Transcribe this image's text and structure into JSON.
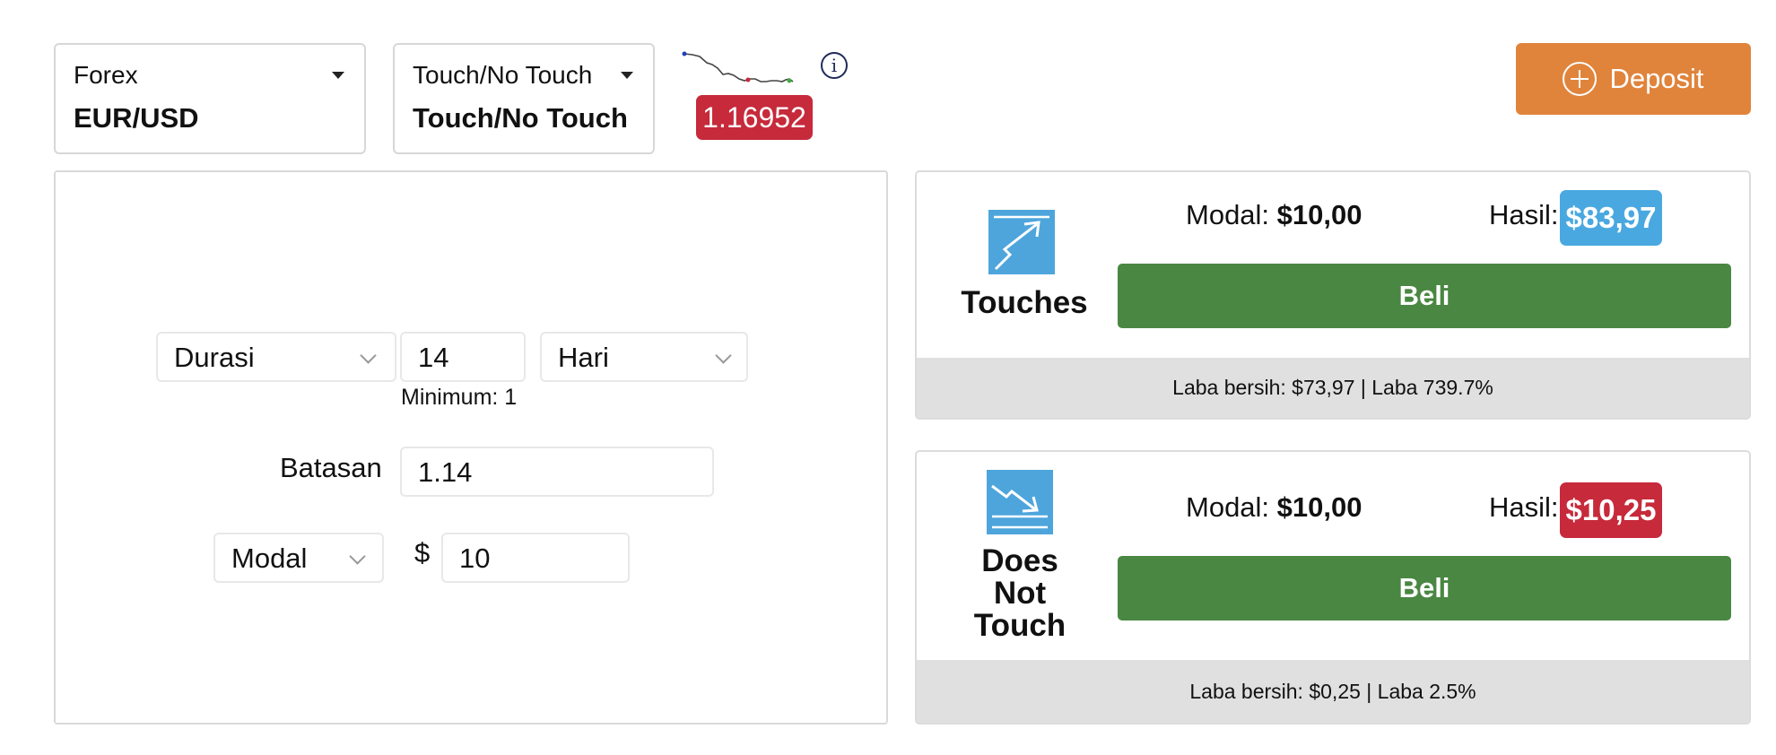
{
  "selectors": {
    "market": {
      "category": "Forex",
      "value": "EUR/USD"
    },
    "type": {
      "category": "Touch/No Touch",
      "value": "Touch/No Touch"
    }
  },
  "price": "1.16952",
  "info_icon": "info-icon",
  "deposit": {
    "label": "Deposit",
    "icon": "plus-circle-icon"
  },
  "form": {
    "duration_select": "Durasi",
    "duration_value": "14",
    "duration_unit": "Hari",
    "minimum": "Minimum: 1",
    "barrier_label": "Batasan",
    "barrier_value": "1.14",
    "amount_select": "Modal",
    "currency_symbol": "$",
    "amount_value": "10"
  },
  "contracts": [
    {
      "title": "Touches",
      "icon": "touch-arrow-icon",
      "modal_label": "Modal:",
      "modal_value": "$10,00",
      "hasil_label": "Hasil:",
      "hasil_value": "$83,97",
      "hasil_color": "#4aa8e0",
      "buy_label": "Beli",
      "footer": "Laba bersih: $73,97 | Laba 739.7%"
    },
    {
      "title": "Does Not Touch",
      "icon": "no-touch-arrow-icon",
      "modal_label": "Modal:",
      "modal_value": "$10,00",
      "hasil_label": "Hasil:",
      "hasil_value": "$10,25",
      "hasil_color": "#c62a3b",
      "buy_label": "Beli",
      "footer": "Laba bersih: $0,25 | Laba 2.5%"
    }
  ],
  "colors": {
    "price_badge": "#c62a3b",
    "deposit": "#e0843c",
    "buy": "#4a8742",
    "footer_bg": "#e0e0e0"
  }
}
